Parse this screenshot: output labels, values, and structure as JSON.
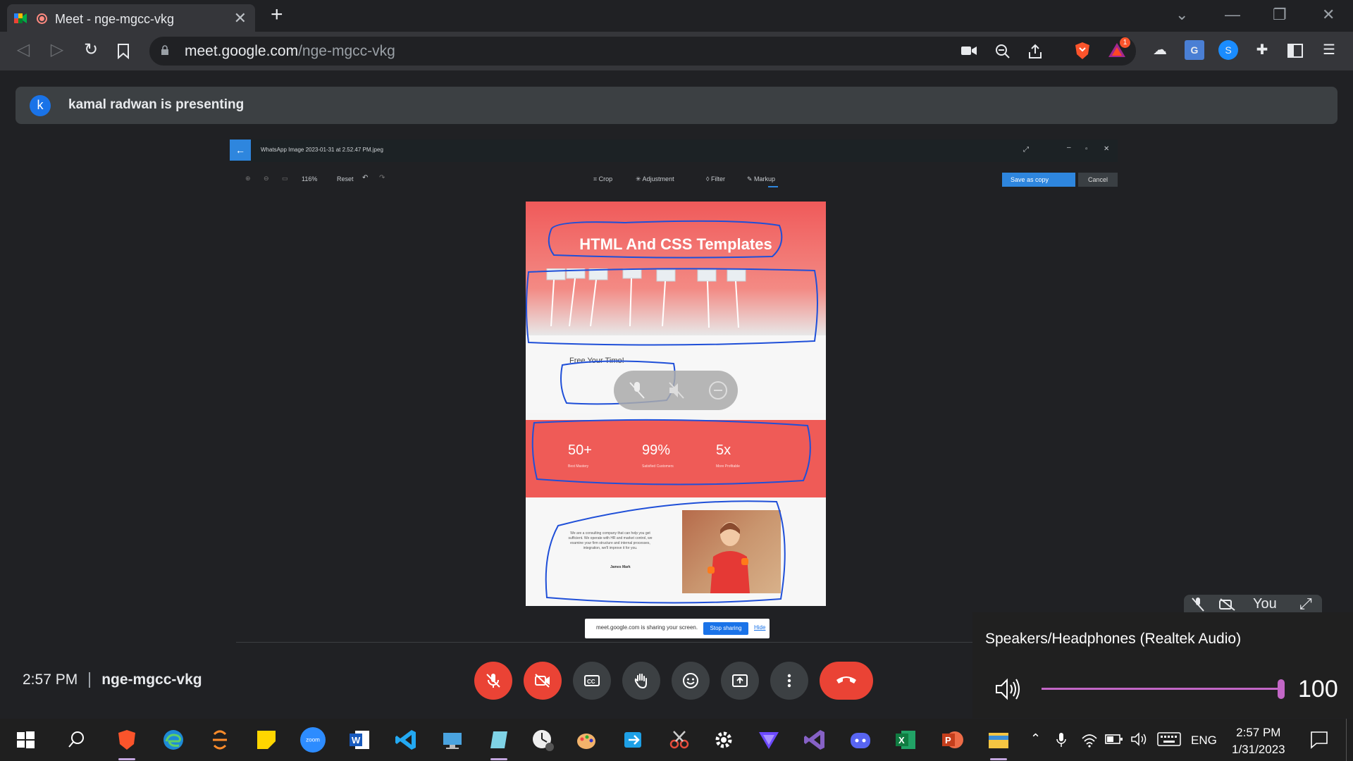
{
  "browser": {
    "tab_title": "Meet - nge-mgcc-vkg",
    "url_domain": "meet.google.com",
    "url_path": "/nge-mgcc-vkg",
    "extension_badge": "1"
  },
  "meet": {
    "presenter_initial": "k",
    "presenting_text": "kamal radwan is presenting",
    "time": "2:57 PM",
    "meeting_code": "nge-mgcc-vkg",
    "self_label": "You"
  },
  "shared_screen": {
    "file_name": "WhatsApp Image 2023-01-31 at 2.52.47 PM.jpeg",
    "zoom": "116%",
    "reset": "Reset",
    "tools": [
      "Crop",
      "Adjustment",
      "Filter",
      "Markup"
    ],
    "save_label": "Save as copy",
    "cancel_label": "Cancel",
    "page_title": "HTML And CSS Templates",
    "feature_heading": "Free Your Time!",
    "stats": [
      {
        "value": "50+",
        "label": "Best Mastery"
      },
      {
        "value": "99%",
        "label": "Satisfied Customers"
      },
      {
        "value": "5x",
        "label": "More Profitable"
      }
    ],
    "about_text": "We are a consulting company that can help you get sufficient. We operate with HR and market control, we examine your firm structure and internal processes, integration, we'll improve it for you.",
    "about_author": "James Mark",
    "sharing_text": "meet.google.com is sharing your screen.",
    "stop_sharing": "Stop sharing",
    "hide": "Hide"
  },
  "volume": {
    "device": "Speakers/Headphones (Realtek Audio)",
    "level": 100
  },
  "taskbar": {
    "time": "2:57 PM",
    "date": "1/31/2023",
    "language": "ENG",
    "zoom_label": "zoom"
  },
  "colors": {
    "meet_red": "#ea4335",
    "accent_blue": "#1a73e8",
    "volume_accent": "#c266c6",
    "template_red": "#ef5b57"
  }
}
